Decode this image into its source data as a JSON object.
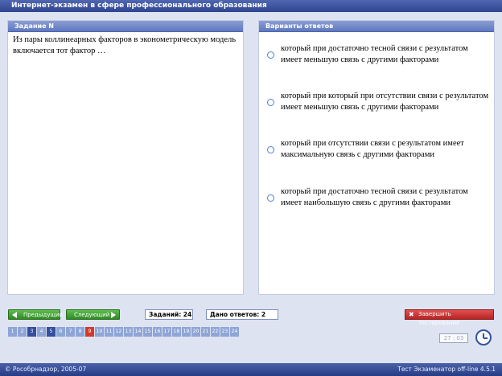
{
  "window": {
    "title": "Интернет-экзамен в сфере профессионального образования"
  },
  "question_panel": {
    "header": "Задание N",
    "text": "Из пары коллинеарных факторов в эконометрическую модель включается тот фактор …"
  },
  "answers_panel": {
    "header": "Варианты ответов",
    "options": [
      {
        "text": "который при достаточно тесной связи с результатом имеет меньшую связь с другими факторами"
      },
      {
        "text": "который при который при отсутствии связи с результатом имеет меньшую связь с другими факторами"
      },
      {
        "text": "который при отсутствии связи с результатом имеет максимальную связь с другими факторами"
      },
      {
        "text": "который при достаточно тесной связи с результатом имеет наибольшую связь с другими факторами"
      }
    ]
  },
  "navigation": {
    "prev_label": "Предыдущий",
    "next_label": "Следующий",
    "tasks_label": "Заданий: 24",
    "answers_given_label": "Дано ответов: 2",
    "finish_label": "Завершить тестирование"
  },
  "pager": {
    "pages": [
      {
        "num": "1",
        "state": "normal"
      },
      {
        "num": "2",
        "state": "normal"
      },
      {
        "num": "3",
        "state": "dark"
      },
      {
        "num": "4",
        "state": "normal"
      },
      {
        "num": "5",
        "state": "dark"
      },
      {
        "num": "6",
        "state": "normal"
      },
      {
        "num": "7",
        "state": "normal"
      },
      {
        "num": "8",
        "state": "normal"
      },
      {
        "num": "9",
        "state": "current"
      },
      {
        "num": "10",
        "state": "normal"
      },
      {
        "num": "11",
        "state": "normal"
      },
      {
        "num": "12",
        "state": "normal"
      },
      {
        "num": "13",
        "state": "normal"
      },
      {
        "num": "14",
        "state": "normal"
      },
      {
        "num": "15",
        "state": "normal"
      },
      {
        "num": "16",
        "state": "normal"
      },
      {
        "num": "17",
        "state": "normal"
      },
      {
        "num": "18",
        "state": "normal"
      },
      {
        "num": "19",
        "state": "normal"
      },
      {
        "num": "20",
        "state": "normal"
      },
      {
        "num": "21",
        "state": "normal"
      },
      {
        "num": "22",
        "state": "normal"
      },
      {
        "num": "23",
        "state": "normal"
      },
      {
        "num": "24",
        "state": "normal"
      }
    ]
  },
  "timer": {
    "value": "27 : 03",
    "icon": "clock-icon"
  },
  "footer": {
    "copyright": "© Рособрнадзор, 2005-07",
    "version": "Тест Экзаменатор off-line 4.5.1"
  },
  "colors": {
    "title_bar": "#2f4590",
    "panel_header": "#6b82c6",
    "nav_button": "#3e9a31",
    "finish_button": "#c52e2e",
    "current_page": "#d23b2c"
  }
}
